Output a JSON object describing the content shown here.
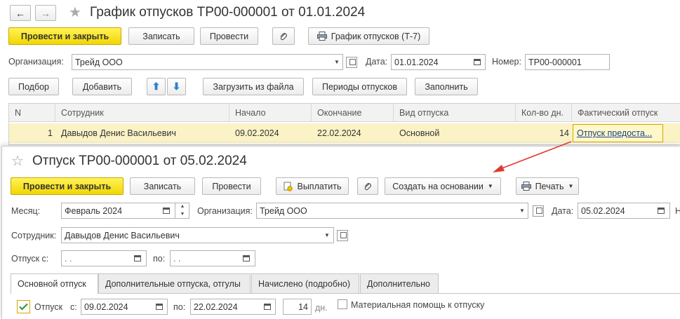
{
  "bg_doc": {
    "nav": {
      "back": "←",
      "forward": "→",
      "star": "★"
    },
    "title": "График отпусков ТР00-000001 от 01.01.2024",
    "toolbar": {
      "post_close": "Провести и закрыть",
      "save": "Записать",
      "post": "Провести",
      "report": "График отпусков (Т-7)"
    },
    "org_label": "Организация:",
    "org_value": "Трейд ООО",
    "date_label": "Дата:",
    "date_value": "01.01.2024",
    "number_label": "Номер:",
    "number_value": "ТР00-000001",
    "table_toolbar": {
      "select": "Подбор",
      "add": "Добавить",
      "load": "Загрузить из файла",
      "periods": "Периоды отпусков",
      "fill": "Заполнить"
    },
    "columns": [
      "N",
      "Сотрудник",
      "Начало",
      "Окончание",
      "Вид отпуска",
      "Кол-во дн.",
      "Фактический отпуск"
    ],
    "rows": [
      {
        "n": "1",
        "employee": "Давыдов Денис Васильевич",
        "start": "09.02.2024",
        "end": "22.02.2024",
        "kind": "Основной",
        "days": "14",
        "actual": "Отпуск предоста..."
      }
    ]
  },
  "fg_doc": {
    "star": "☆",
    "title": "Отпуск ТР00-000001 от 05.02.2024",
    "toolbar": {
      "post_close": "Провести и закрыть",
      "save": "Записать",
      "post": "Провести",
      "pay": "Выплатить",
      "create_basis": "Создать на основании",
      "print": "Печать"
    },
    "month_label": "Месяц:",
    "month_value": "Февраль 2024",
    "org_label": "Организация:",
    "org_value": "Трейд ООО",
    "date_label": "Дата:",
    "date_value": "05.02.2024",
    "cut_label": "Н",
    "employee_label": "Сотрудник:",
    "employee_value": "Давыдов Денис Васильевич",
    "leave_from_label": "Отпуск с:",
    "leave_from_value": " .  .",
    "leave_to_label": "по:",
    "leave_to_value": " .  .",
    "tabs": [
      "Основной отпуск",
      "Дополнительные отпуска, отгулы",
      "Начислено (подробно)",
      "Дополнительно"
    ],
    "main_leave": {
      "checkbox_label": "Отпуск",
      "from_label": "с:",
      "from_value": "09.02.2024",
      "to_label": "по:",
      "to_value": "22.02.2024",
      "days_value": "14",
      "days_unit": "дн.",
      "aid_label": "Материальная помощь к отпуску"
    }
  },
  "colors": {
    "primary": "#f5dc00",
    "link": "#1a3f8f",
    "row_highlight": "#fbf2c6",
    "arrow": "#e03a2f"
  }
}
